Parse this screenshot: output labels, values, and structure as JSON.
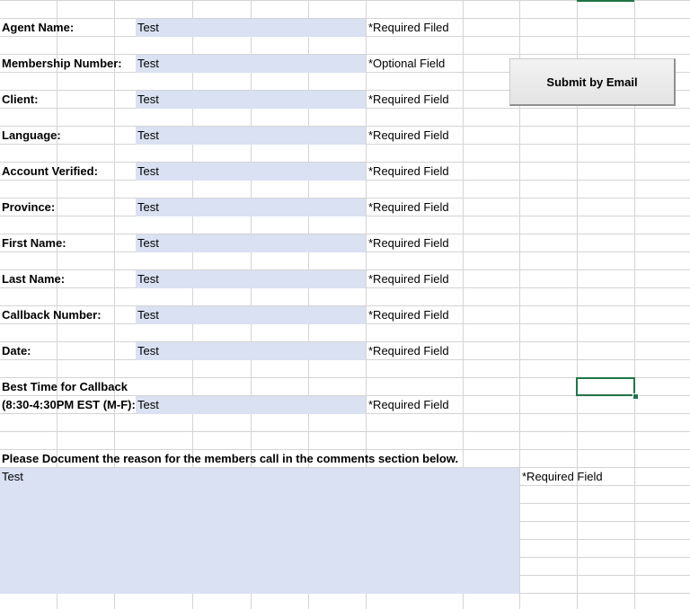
{
  "form": {
    "rows": [
      {
        "label": "Agent Name:",
        "value": "Test",
        "note": "*Required Filed"
      },
      {
        "label": "Membership Number:",
        "value": "Test",
        "note": "*Optional Field"
      },
      {
        "label": "Client:",
        "value": "Test",
        "note": "*Required Field"
      },
      {
        "label": "Language:",
        "value": "Test",
        "note": "*Required Field"
      },
      {
        "label": "Account Verified:",
        "value": "Test",
        "note": "*Required Field"
      },
      {
        "label": "Province:",
        "value": "Test",
        "note": "*Required Field"
      },
      {
        "label": "First Name:",
        "value": "Test",
        "note": "*Required Field"
      },
      {
        "label": "Last Name:",
        "value": "Test",
        "note": "*Required Field"
      },
      {
        "label": "Callback Number:",
        "value": "Test",
        "note": "*Required Field"
      },
      {
        "label": "Date:",
        "value": "Test",
        "note": "*Required Field"
      }
    ],
    "best_time": {
      "label_line1": "Best Time for Callback",
      "label_line2": "(8:30-4:30PM EST (M-F):",
      "value": "Test",
      "note": "*Required Field"
    },
    "comments": {
      "instruction": "Please Document the reason for the members call in the comments section below.",
      "value": "Test",
      "note": "*Required Field"
    },
    "submit_label": "Submit by Email"
  },
  "colors": {
    "input_fill": "#d9e1f2",
    "gridline": "#d4d4d4",
    "selection": "#217346"
  }
}
